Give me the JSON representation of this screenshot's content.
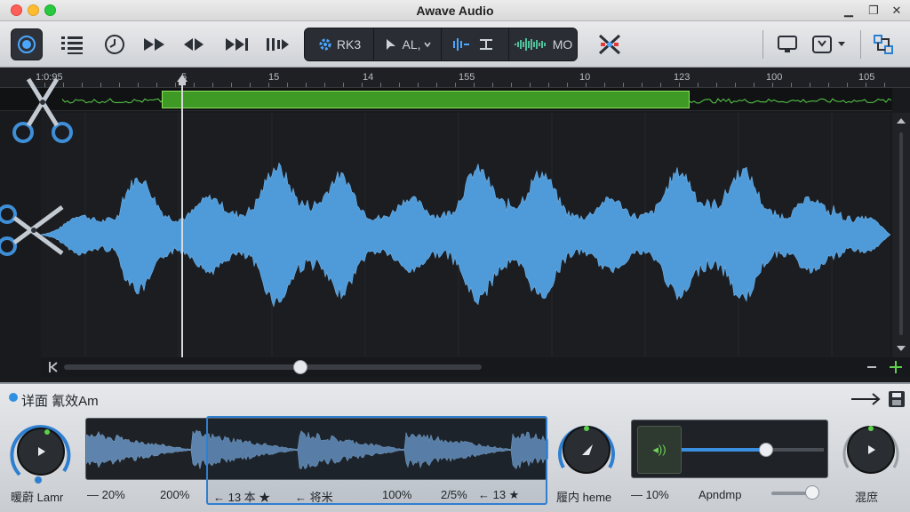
{
  "window": {
    "title": "Awave Audio"
  },
  "toolbar": {
    "effects": [
      {
        "label": "RK3"
      },
      {
        "label": "AL,"
      },
      {
        "label": ""
      },
      {
        "label": "MO"
      }
    ]
  },
  "ruler": {
    "labels": [
      "1:0:95",
      "5",
      "15",
      "14",
      "155",
      "10",
      "123",
      "100",
      "105"
    ]
  },
  "editor": {
    "playhead_fraction": 0.17,
    "selection": {
      "start_fraction": 0.18,
      "end_fraction": 0.77
    },
    "hscroll_fraction": 0.61
  },
  "panel": {
    "title": "详面 氰效Am",
    "knob1_label": "暖蔚 Lamr",
    "knob2_label": "履内 heme",
    "knob3_label": "混庶",
    "values": {
      "v1": "— 20%",
      "v2": "200%",
      "v3": "← 13 本 ★",
      "v4": "← 将米",
      "v5": "100%",
      "v6": "2/5%",
      "v7": "← 13 ★",
      "v8": "— 10%",
      "v9": "Apndmp"
    },
    "mix_level_fraction": 0.59
  },
  "colors": {
    "waveform": "#4f9ad8",
    "selection": "#3f9a25",
    "accent": "#2f8fe0"
  }
}
